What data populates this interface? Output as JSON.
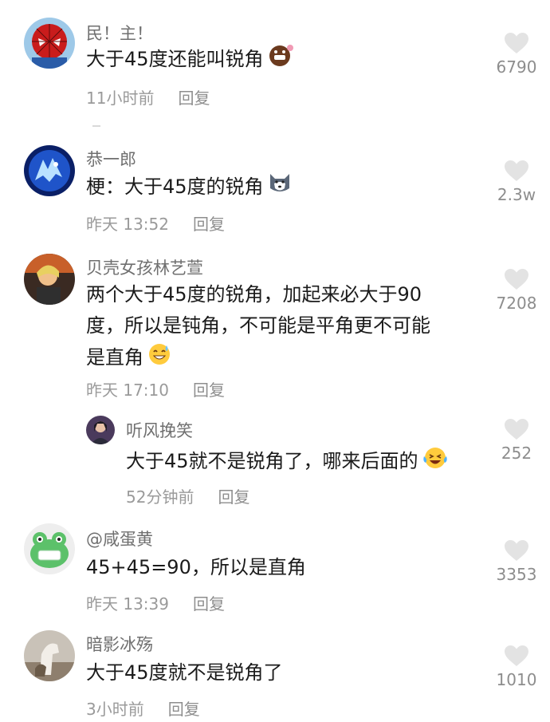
{
  "comments": [
    {
      "user": "民！主！",
      "text": "大于45度还能叫锐角",
      "time": "11小时前",
      "reply": "回复",
      "likes": "6790",
      "emoji": "grinning-face-emoji"
    },
    {
      "user": "恭一郎",
      "text": "梗：大于45度的锐角",
      "time": "昨天 13:52",
      "reply": "回复",
      "likes": "2.3w",
      "emoji": "husky-dog-emoji"
    },
    {
      "user": "贝壳女孩林艺萱",
      "line1": "两个大于45度的锐角，加起来必大于90",
      "line2": "度，所以是钝角，不可能是平角更不可能",
      "line3": "是直角",
      "time": "昨天 17:10",
      "reply": "回复",
      "likes": "7208",
      "emoji": "sweat-smile-emoji"
    },
    {
      "user": "听风挽笑",
      "text": "大于45就不是锐角了，哪来后面的",
      "time": "52分钟前",
      "reply": "回复",
      "likes": "252",
      "emoji": "laughing-tears-emoji"
    },
    {
      "user": "@咸蛋黄",
      "text": "45+45=90，所以是直角",
      "time": "昨天 13:39",
      "reply": "回复",
      "likes": "3353"
    },
    {
      "user": "暗影冰殇",
      "text": "大于45度就不是锐角了",
      "time": "3小时前",
      "reply": "回复",
      "likes": "1010"
    }
  ],
  "colors": {
    "username": "#6f6f6f",
    "text": "#1b1b1b",
    "meta": "#9a9a9a",
    "heart": "#e3e3e3"
  },
  "icons": {
    "like": "heart-icon"
  }
}
